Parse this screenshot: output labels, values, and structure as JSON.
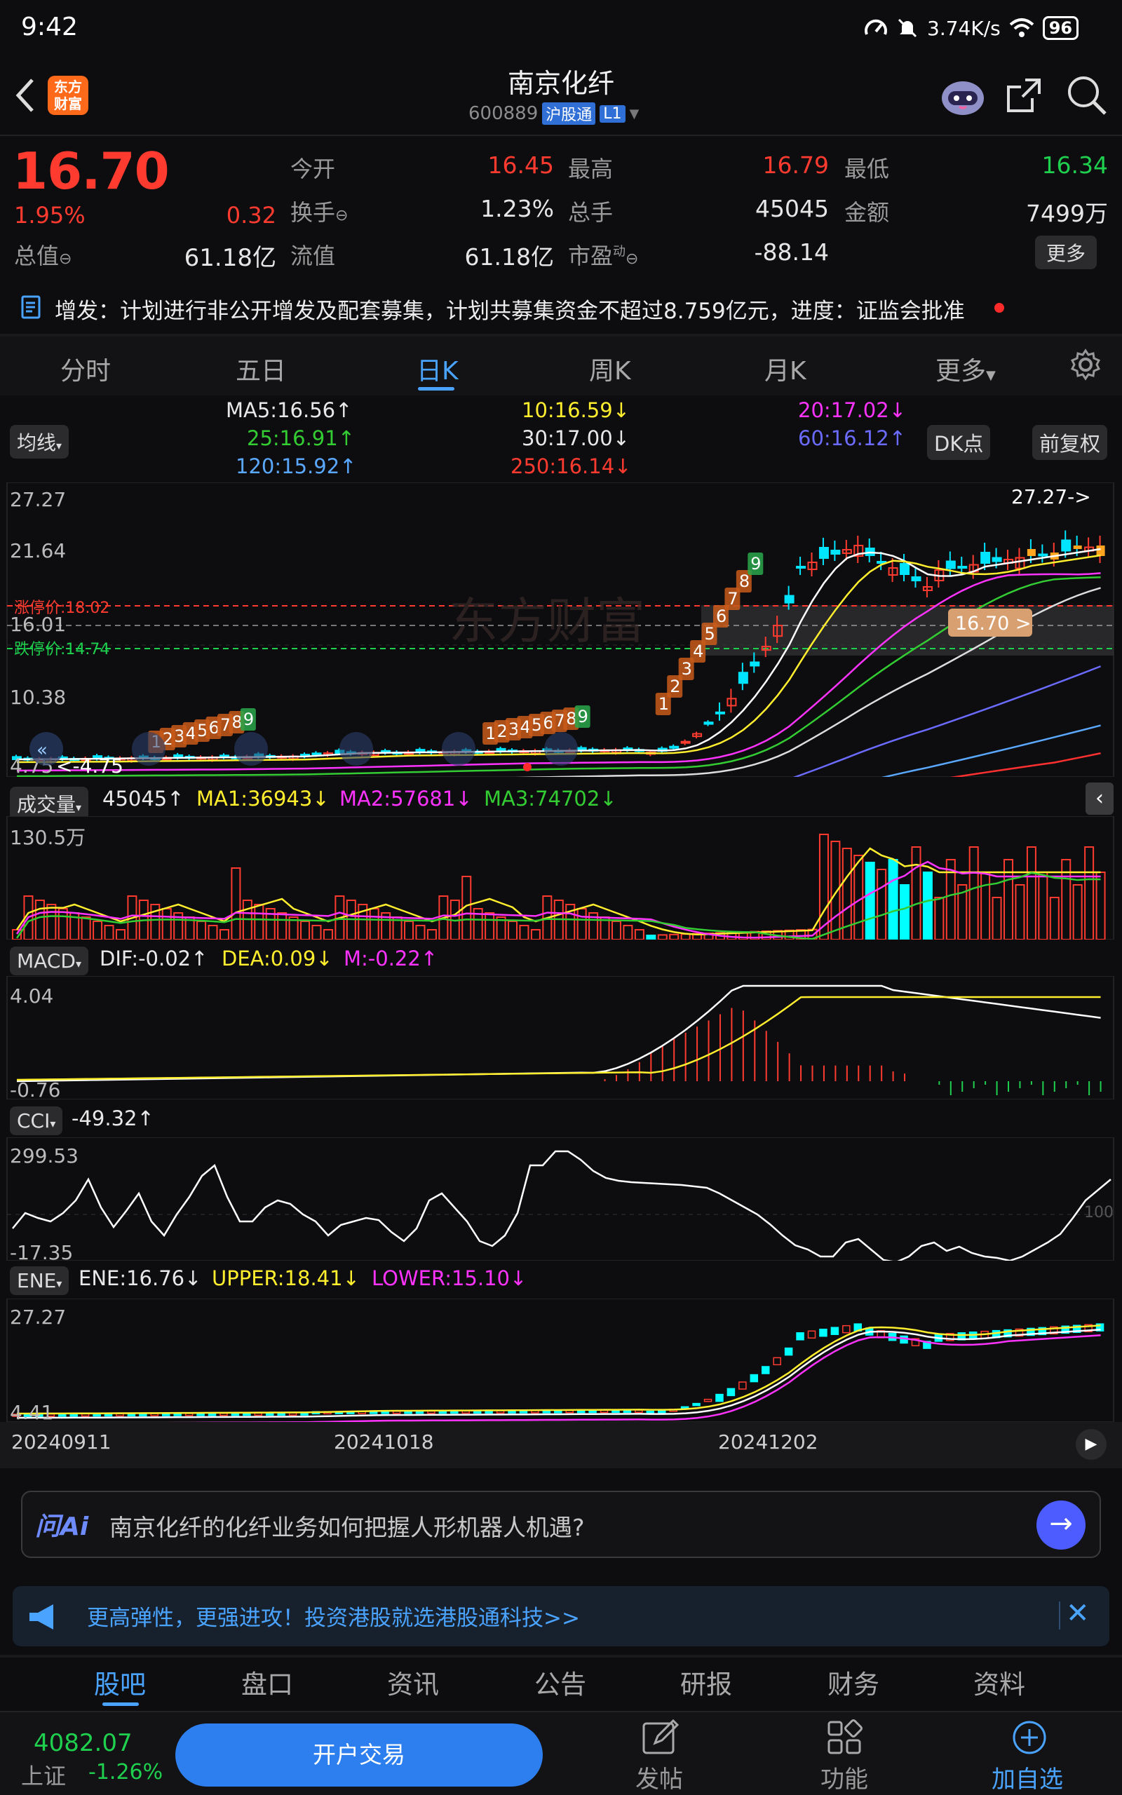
{
  "status_bar": {
    "time": "9:42",
    "speed": "3.74K/s",
    "battery": "96"
  },
  "header": {
    "title": "南京化纤",
    "code": "600889",
    "badge": "沪股通",
    "level": "L1",
    "brand": "东方\n财富"
  },
  "quote": {
    "price": "16.70",
    "pct": "1.95%",
    "chg": "0.32",
    "open_label": "今开",
    "open": "16.45",
    "high_label": "最高",
    "high": "16.79",
    "low_label": "最低",
    "low": "16.34",
    "turnover_label": "换手",
    "turnover": "1.23%",
    "volume_label": "总手",
    "volume": "45045",
    "amount_label": "金额",
    "amount": "7499万",
    "mktcap_label": "总值",
    "mktcap": "61.18亿",
    "float_label": "流值",
    "float": "61.18亿",
    "pe_label": "市盈",
    "pe_sup": "动",
    "pe": "-88.14",
    "more": "更多"
  },
  "notice": "增发：计划进行非公开增发及配套募集，计划共募集资金不超过8.759亿元，进度：证监会批准",
  "period_tabs": [
    "分时",
    "五日",
    "日K",
    "周K",
    "月K",
    "更多"
  ],
  "active_period": 2,
  "ma_panel": {
    "selector": "均线",
    "ma5": "MA5:16.56↑",
    "ma10": "10:16.59↓",
    "ma20": "20:17.02↓",
    "ma25": "25:16.91↑",
    "ma30": "30:17.00↓",
    "ma60": "60:16.12↑",
    "ma120": "120:15.92↑",
    "ma250": "250:16.14↓",
    "dk_button": "DK点",
    "adjust_button": "前复权"
  },
  "kline": {
    "y_labels": [
      "27.27",
      "21.64",
      "16.01",
      "10.38",
      "4.75"
    ],
    "limit_up": "涨停价:18.02",
    "limit_down": "跌停价:14.74",
    "max_marker": "27.27->",
    "min_marker": "<-4.75",
    "price_tag": "16.70 >",
    "watermark": "东方财富",
    "td_seq_1": [
      "1",
      "2",
      "3",
      "4",
      "5",
      "6",
      "7",
      "8",
      "9"
    ],
    "td_seq_2": [
      "1",
      "2",
      "3",
      "4",
      "5",
      "6",
      "7",
      "8",
      "9"
    ],
    "td_seq_3": [
      "1",
      "2",
      "3",
      "4",
      "5",
      "6",
      "7",
      "8",
      "9"
    ]
  },
  "volume_panel": {
    "selector": "成交量",
    "vol": "45045↑",
    "ma1": "MA1:36943↓",
    "ma2": "MA2:57681↓",
    "ma3": "MA3:74702↓",
    "y_max": "130.5万"
  },
  "macd_panel": {
    "selector": "MACD",
    "dif": "DIF:-0.02↑",
    "dea": "DEA:0.09↓",
    "m": "M:-0.22↑",
    "y_max": "4.04",
    "y_min": "-0.76"
  },
  "cci_panel": {
    "selector": "CCI",
    "value": "-49.32↑",
    "y_max": "299.53",
    "y_min": "-17.35",
    "ref": "100"
  },
  "ene_panel": {
    "selector": "ENE",
    "ene": "ENE:16.76↓",
    "upper": "UPPER:18.41↓",
    "lower": "LOWER:15.10↓",
    "y_max": "27.27",
    "y_min": "4.41"
  },
  "x_axis": [
    "20240911",
    "20241018",
    "20241202"
  ],
  "ai_bar": {
    "logo": "问Ai",
    "question": "南京化纤的化纤业务如何把握人形机器人机遇?"
  },
  "promo": "更高弹性，更强进攻！投资港股就选港股通科技>>",
  "content_tabs": [
    "股吧",
    "盘口",
    "资讯",
    "公告",
    "研报",
    "财务",
    "资料"
  ],
  "active_content_tab": 0,
  "bottom_nav": {
    "index_value": "4082.07",
    "index_name": "上证",
    "index_pct": "-1.26%",
    "trade_button": "开户交易",
    "post": "发帖",
    "func": "功能",
    "watch": "加自选"
  },
  "colors": {
    "up": "#ff3b30",
    "down": "#1fcf4e",
    "cyan": "#00ffff",
    "accent": "#4aa3ff",
    "bg": "#0d0d0f"
  }
}
